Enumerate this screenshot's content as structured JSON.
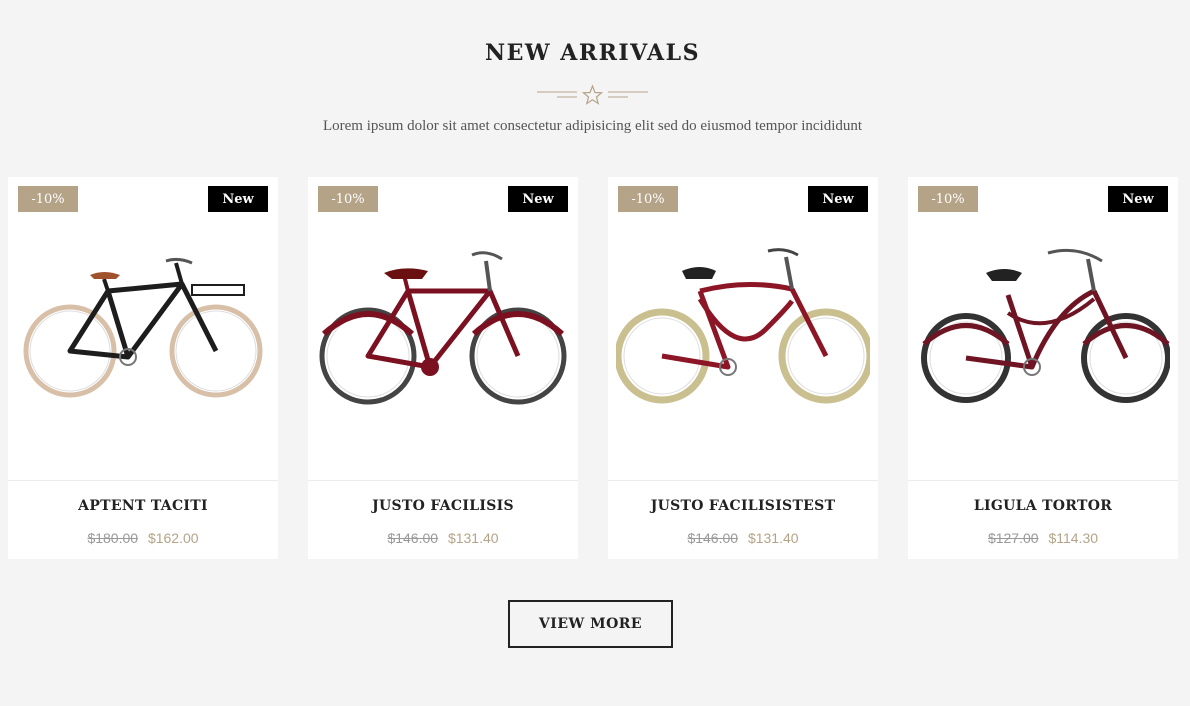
{
  "section": {
    "title": "NEW ARRIVALS",
    "subtitle": "Lorem ipsum dolor sit amet consectetur adipisicing elit sed do eiusmod tempor incididunt"
  },
  "products": [
    {
      "name": "APTENT TACITI",
      "discount": "-10%",
      "badge": "New",
      "old_price": "$180.00",
      "price": "$162.00",
      "icon": "bicycle-black-icon",
      "frame_color": "#1d1d1d",
      "tire_color": "#d8bfa8"
    },
    {
      "name": "JUSTO FACILISIS",
      "discount": "-10%",
      "badge": "New",
      "old_price": "$146.00",
      "price": "$131.40",
      "icon": "bicycle-red-icon",
      "frame_color": "#7a1020",
      "tire_color": "#444444"
    },
    {
      "name": "JUSTO FACILISISTEST",
      "discount": "-10%",
      "badge": "New",
      "old_price": "$146.00",
      "price": "$131.40",
      "icon": "cruiser-bicycle-icon",
      "frame_color": "#8c1526",
      "tire_color": "#c9bf8f"
    },
    {
      "name": "LIGULA TORTOR",
      "discount": "-10%",
      "badge": "New",
      "old_price": "$127.00",
      "price": "$114.30",
      "icon": "step-through-bicycle-icon",
      "frame_color": "#6e1423",
      "tire_color": "#333333"
    }
  ],
  "actions": {
    "view_more": "VIEW MORE"
  },
  "colors": {
    "accent": "#b5a388",
    "background": "#f4f4f4",
    "badge_new": "#000000"
  }
}
